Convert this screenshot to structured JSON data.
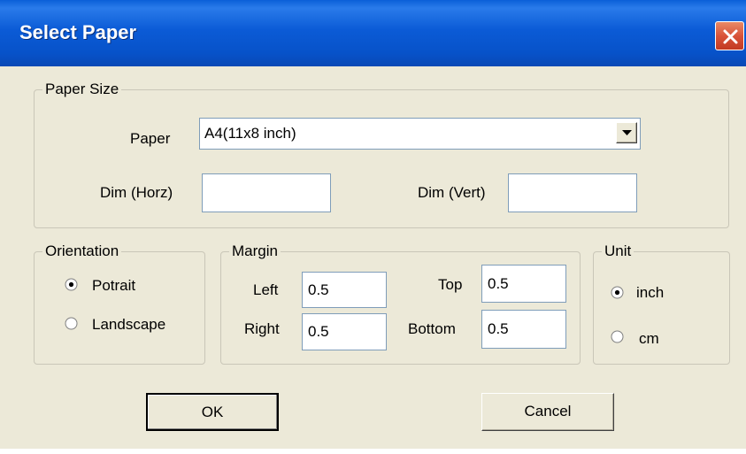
{
  "window": {
    "title": "Select Paper",
    "close_icon": "close-icon"
  },
  "paper_size": {
    "legend": "Paper Size",
    "paper_label": "Paper",
    "paper_value": "A4(11x8 inch)",
    "dim_horz_label": "Dim (Horz)",
    "dim_horz_value": "",
    "dim_vert_label": "Dim (Vert)",
    "dim_vert_value": ""
  },
  "orientation": {
    "legend": "Orientation",
    "options": [
      {
        "label": "Potrait",
        "selected": true
      },
      {
        "label": "Landscape",
        "selected": false
      }
    ]
  },
  "margin": {
    "legend": "Margin",
    "left_label": "Left",
    "left_value": "0.5",
    "top_label": "Top",
    "top_value": "0.5",
    "right_label": "Right",
    "right_value": "0.5",
    "bottom_label": "Bottom",
    "bottom_value": "0.5"
  },
  "unit": {
    "legend": "Unit",
    "options": [
      {
        "label": "inch",
        "selected": true
      },
      {
        "label": "cm",
        "selected": false
      }
    ]
  },
  "buttons": {
    "ok_label": "OK",
    "cancel_label": "Cancel"
  },
  "colors": {
    "titlebar": "#0b5bd6",
    "dialog_bg": "#ece9d8",
    "close_button": "#d9543a"
  }
}
